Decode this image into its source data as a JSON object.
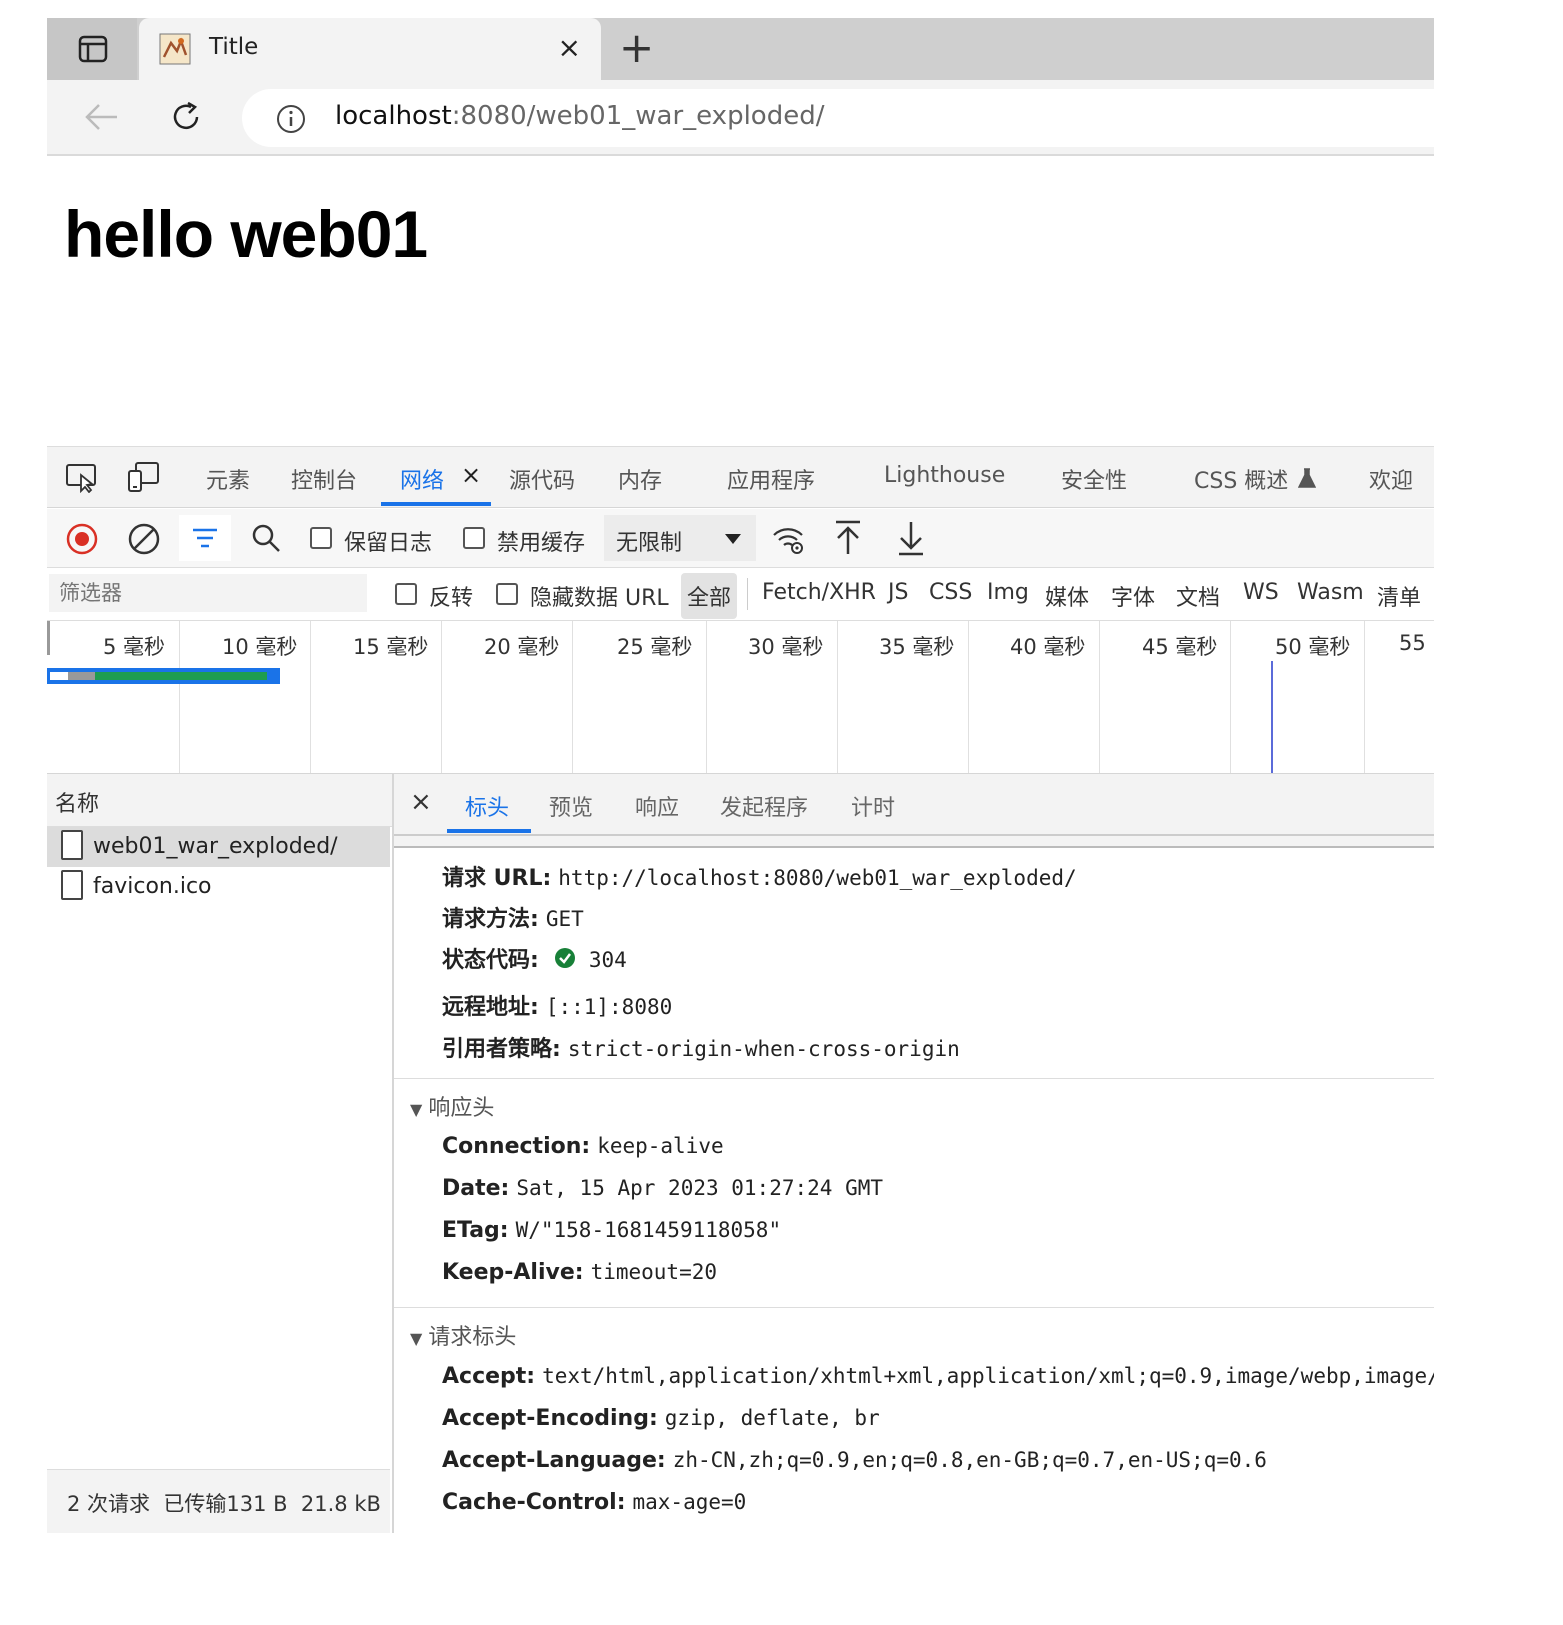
{
  "browser": {
    "tab_title": "Title",
    "tab_close": "×",
    "new_tab": "+",
    "url_host": "localhost",
    "url_path": ":8080/web01_war_exploded/"
  },
  "page": {
    "heading": "hello web01"
  },
  "devtools": {
    "tabs": [
      "元素",
      "控制台",
      "网络",
      "源代码",
      "内存",
      "应用程序",
      "Lighthouse",
      "安全性",
      "CSS 概述",
      "欢迎"
    ],
    "active_tab": "网络",
    "network_toolbar": {
      "preserve_log": "保留日志",
      "disable_cache": "禁用缓存",
      "throttling": "无限制"
    },
    "filter": {
      "placeholder": "筛选器",
      "invert": "反转",
      "hide_data_urls": "隐藏数据 URL",
      "types": [
        "全部",
        "Fetch/XHR",
        "JS",
        "CSS",
        "Img",
        "媒体",
        "字体",
        "文档",
        "WS",
        "Wasm",
        "清单"
      ],
      "active_type": "全部"
    },
    "timeline": {
      "ticks": [
        "5 毫秒",
        "10 毫秒",
        "15 毫秒",
        "20 毫秒",
        "25 毫秒",
        "30 毫秒",
        "35 毫秒",
        "40 毫秒",
        "45 毫秒",
        "50 毫秒",
        "55"
      ]
    },
    "requests": {
      "column_header": "名称",
      "items": [
        "web01_war_exploded/",
        "favicon.ico"
      ],
      "summary": "2 次请求  已传输131 B  21.8 kB"
    },
    "details": {
      "tabs": [
        "标头",
        "预览",
        "响应",
        "发起程序",
        "计时"
      ],
      "active_tab": "标头",
      "general": [
        {
          "key": "请求 URL:",
          "value": "http://localhost:8080/web01_war_exploded/"
        },
        {
          "key": "请求方法:",
          "value": "GET"
        },
        {
          "key": "状态代码:",
          "value": "304"
        },
        {
          "key": "远程地址:",
          "value": "[::1]:8080"
        },
        {
          "key": "引用者策略:",
          "value": "strict-origin-when-cross-origin"
        }
      ],
      "response_headers_title": "响应头",
      "response_headers": [
        {
          "key": "Connection:",
          "value": "keep-alive"
        },
        {
          "key": "Date:",
          "value": "Sat, 15 Apr 2023 01:27:24 GMT"
        },
        {
          "key": "ETag:",
          "value": "W/\"158-1681459118058\""
        },
        {
          "key": "Keep-Alive:",
          "value": "timeout=20"
        }
      ],
      "request_headers_title": "请求标头",
      "request_headers": [
        {
          "key": "Accept:",
          "value": "text/html,application/xhtml+xml,application/xml;q=0.9,image/webp,image/"
        },
        {
          "key": "Accept-Encoding:",
          "value": "gzip, deflate, br"
        },
        {
          "key": "Accept-Language:",
          "value": "zh-CN,zh;q=0.9,en;q=0.8,en-GB;q=0.7,en-US;q=0.6"
        },
        {
          "key": "Cache-Control:",
          "value": "max-age=0"
        }
      ]
    }
  },
  "colors": {
    "accent": "#1a73e8",
    "record": "#d93025",
    "status_ok": "#188038"
  }
}
